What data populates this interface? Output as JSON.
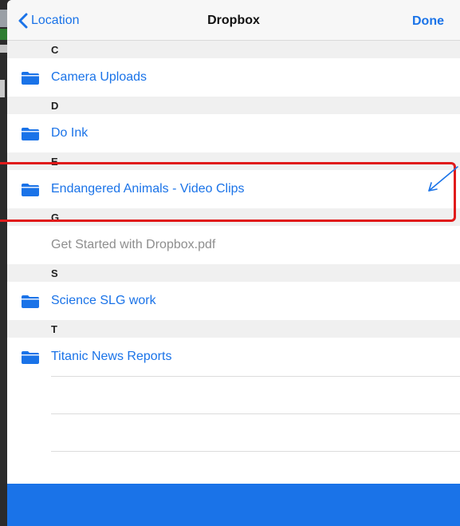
{
  "nav": {
    "back_label": "Location",
    "title": "Dropbox",
    "done_label": "Done"
  },
  "sections": [
    {
      "header": "C",
      "items": [
        {
          "label": "Camera Uploads",
          "type": "folder"
        }
      ]
    },
    {
      "header": "D",
      "items": [
        {
          "label": "Do Ink",
          "type": "folder"
        }
      ]
    },
    {
      "header": "E",
      "items": [
        {
          "label": "Endangered Animals - Video Clips",
          "type": "folder"
        }
      ]
    },
    {
      "header": "G",
      "items": [
        {
          "label": "Get Started with Dropbox.pdf",
          "type": "file"
        }
      ]
    },
    {
      "header": "S",
      "items": [
        {
          "label": "Science SLG work",
          "type": "folder"
        }
      ]
    },
    {
      "header": "T",
      "items": [
        {
          "label": "Titanic News Reports",
          "type": "folder"
        }
      ]
    }
  ],
  "colors": {
    "accent": "#1a73e8",
    "annotation": "#e01b1b",
    "file_text": "#8e8e8e"
  },
  "icons": {
    "back": "chevron-left-icon",
    "folder": "folder-icon",
    "annotation": "arrow-icon"
  }
}
